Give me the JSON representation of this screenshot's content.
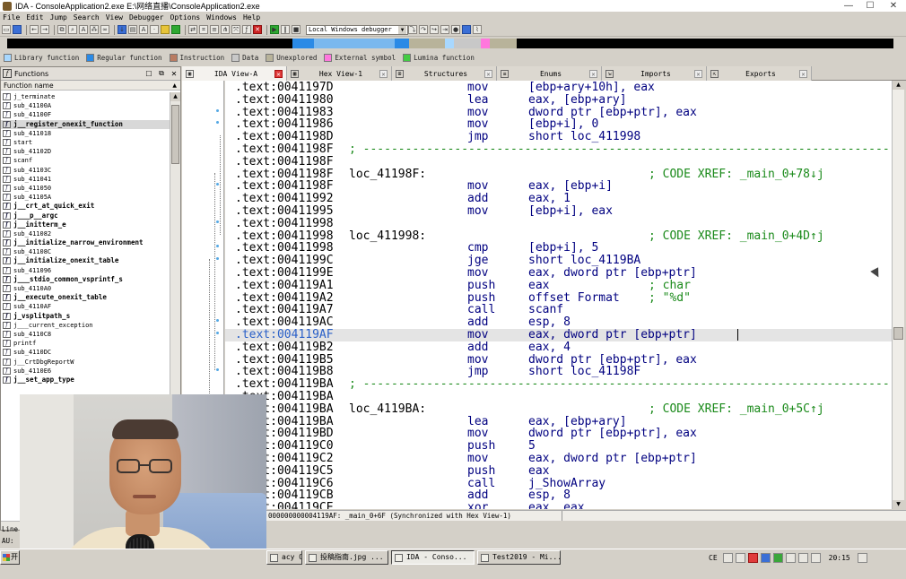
{
  "title": "IDA - ConsoleApplication2.exe E:\\网络直播\\ConsoleApplication2.exe",
  "menu": [
    "File",
    "Edit",
    "Jump",
    "Search",
    "View",
    "Debugger",
    "Options",
    "Windows",
    "Help"
  ],
  "debugger_select": "Local Windows debugger",
  "legend": [
    {
      "label": "Library function",
      "color": "#a8d8ff"
    },
    {
      "label": "Regular function",
      "color": "#2a8ae6"
    },
    {
      "label": "Instruction",
      "color": "#b97b62"
    },
    {
      "label": "Data",
      "color": "#c8c8c8"
    },
    {
      "label": "Unexplored",
      "color": "#b8b39a"
    },
    {
      "label": "External symbol",
      "color": "#ff77dd"
    },
    {
      "label": "Lumina function",
      "color": "#44cc44"
    }
  ],
  "functions_panel": {
    "title": "Functions",
    "column": "Function name",
    "items": [
      {
        "name": "j_terminate",
        "bold": false
      },
      {
        "name": "sub_41100A",
        "bold": false
      },
      {
        "name": "sub_41100F",
        "bold": false
      },
      {
        "name": "j__register_onexit_function",
        "bold": true,
        "selected": true
      },
      {
        "name": "sub_411018",
        "bold": false
      },
      {
        "name": "start",
        "bold": false
      },
      {
        "name": "sub_41102D",
        "bold": false
      },
      {
        "name": "scanf",
        "bold": false
      },
      {
        "name": "sub_41103C",
        "bold": false
      },
      {
        "name": "sub_411041",
        "bold": false
      },
      {
        "name": "sub_411050",
        "bold": false
      },
      {
        "name": "sub_41105A",
        "bold": false
      },
      {
        "name": "j__crt_at_quick_exit",
        "bold": true
      },
      {
        "name": "j___p__argc",
        "bold": true
      },
      {
        "name": "j__initterm_e",
        "bold": true
      },
      {
        "name": "sub_411082",
        "bold": false
      },
      {
        "name": "j__initialize_narrow_environment",
        "bold": true
      },
      {
        "name": "sub_41108C",
        "bold": false
      },
      {
        "name": "j__initialize_onexit_table",
        "bold": true
      },
      {
        "name": "sub_411096",
        "bold": false
      },
      {
        "name": "j___stdio_common_vsprintf_s",
        "bold": true
      },
      {
        "name": "sub_4110A0",
        "bold": false
      },
      {
        "name": "j__execute_onexit_table",
        "bold": true
      },
      {
        "name": "sub_4110AF",
        "bold": false
      },
      {
        "name": "j_vsplitpath_s",
        "bold": true
      },
      {
        "name": "j___current_exception",
        "bold": false
      },
      {
        "name": "sub_4110C8",
        "bold": false
      },
      {
        "name": "printf",
        "bold": false
      },
      {
        "name": "sub_4110DC",
        "bold": false
      },
      {
        "name": "j__CrtDbgReportW",
        "bold": false
      },
      {
        "name": "sub_4110E6",
        "bold": false
      },
      {
        "name": "j__set_app_type",
        "bold": true
      }
    ]
  },
  "left_status": [
    "Line",
    "AU:"
  ],
  "tabs": [
    {
      "label": "IDA View-A",
      "active": true
    },
    {
      "label": "Hex View-1",
      "active": false
    },
    {
      "label": "Structures",
      "active": false
    },
    {
      "label": "Enums",
      "active": false
    },
    {
      "label": "Imports",
      "active": false
    },
    {
      "label": "Exports",
      "active": false
    }
  ],
  "code_lines": [
    {
      "addr": ".text:0041197D",
      "mnem": "mov",
      "ops": "[ebp+ary+10h], eax"
    },
    {
      "addr": ".text:00411980",
      "mnem": "lea",
      "ops": "eax, [ebp+ary]"
    },
    {
      "addr": ".text:00411983",
      "mnem": "mov",
      "ops": "dword ptr [ebp+ptr], eax"
    },
    {
      "addr": ".text:00411986",
      "mnem": "mov",
      "ops": "[ebp+i], 0"
    },
    {
      "addr": ".text:0041198D",
      "mnem": "jmp",
      "ops": "short loc_411998"
    },
    {
      "addr": ".text:0041198F",
      "sep": "; ---------------------------------------------------------------------------"
    },
    {
      "addr": ".text:0041198F"
    },
    {
      "addr": ".text:0041198F",
      "label": "loc_41198F:",
      "comment": "; CODE XREF: _main_0+78↓j"
    },
    {
      "addr": ".text:0041198F",
      "mnem": "mov",
      "ops": "eax, [ebp+i]"
    },
    {
      "addr": ".text:00411992",
      "mnem": "add",
      "ops": "eax, 1"
    },
    {
      "addr": ".text:00411995",
      "mnem": "mov",
      "ops": "[ebp+i], eax"
    },
    {
      "addr": ".text:00411998"
    },
    {
      "addr": ".text:00411998",
      "label": "loc_411998:",
      "comment": "; CODE XREF: _main_0+4D↑j"
    },
    {
      "addr": ".text:00411998",
      "mnem": "cmp",
      "ops": "[ebp+i], 5"
    },
    {
      "addr": ".text:0041199C",
      "mnem": "jge",
      "ops": "short loc_4119BA"
    },
    {
      "addr": ".text:0041199E",
      "mnem": "mov",
      "ops": "eax, dword ptr [ebp+ptr]"
    },
    {
      "addr": ".text:004119A1",
      "mnem": "push",
      "ops": "eax",
      "comment": "; char"
    },
    {
      "addr": ".text:004119A2",
      "mnem": "push",
      "ops": "offset Format",
      "comment": "; \"%d\""
    },
    {
      "addr": ".text:004119A7",
      "mnem": "call",
      "ops": "scanf"
    },
    {
      "addr": ".text:004119AC",
      "mnem": "add",
      "ops": "esp, 8"
    },
    {
      "addr": ".text:004119AF",
      "mnem": "mov",
      "ops": "eax, dword ptr [ebp+ptr]",
      "highlight": true
    },
    {
      "addr": ".text:004119B2",
      "mnem": "add",
      "ops": "eax, 4"
    },
    {
      "addr": ".text:004119B5",
      "mnem": "mov",
      "ops": "dword ptr [ebp+ptr], eax"
    },
    {
      "addr": ".text:004119B8",
      "mnem": "jmp",
      "ops": "short loc_41198F"
    },
    {
      "addr": ".text:004119BA",
      "sep": "; ---------------------------------------------------------------------------"
    },
    {
      "addr": ".text:004119BA"
    },
    {
      "addr": ".text:004119BA",
      "label": "loc_4119BA:",
      "comment": "; CODE XREF: _main_0+5C↑j"
    },
    {
      "addr": ".text:004119BA",
      "mnem": "lea",
      "ops": "eax, [ebp+ary]"
    },
    {
      "addr": ".text:004119BD",
      "mnem": "mov",
      "ops": "dword ptr [ebp+ptr], eax"
    },
    {
      "addr": ".text:004119C0",
      "mnem": "push",
      "ops": "5"
    },
    {
      "addr": ".text:004119C2",
      "mnem": "mov",
      "ops": "eax, dword ptr [ebp+ptr]"
    },
    {
      "addr": ".text:004119C5",
      "mnem": "push",
      "ops": "eax"
    },
    {
      "addr": ".text:004119C6",
      "mnem": "call",
      "ops": "j_ShowArray"
    },
    {
      "addr": ".text:004119CB",
      "mnem": "add",
      "ops": "esp, 8"
    },
    {
      "addr": ".text:004119CE",
      "mnem": "xor",
      "ops": "eax, eax"
    }
  ],
  "status_line": "000000000004119AF: _main_0+6F (Synchronized with Hex View-1)",
  "taskbar": {
    "start": "开",
    "buttons": [
      {
        "label": "acy O...",
        "pressed": false
      },
      {
        "label": "投稿指南.jpg ...",
        "pressed": false
      },
      {
        "label": "IDA - Conso...",
        "pressed": true
      },
      {
        "label": "Test2019 - Mi...",
        "pressed": false
      }
    ],
    "tray_lang": "CE",
    "clock": "20:15"
  }
}
